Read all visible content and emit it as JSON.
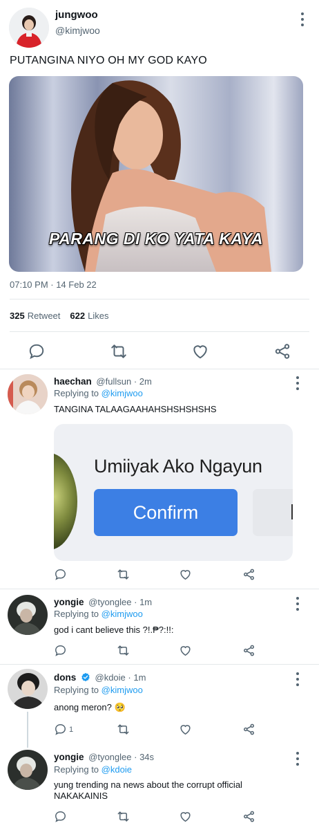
{
  "main_tweet": {
    "display_name": "jungwoo",
    "handle": "@kimjwoo",
    "text": "PUTANGINA NIYO OH MY GOD KAYO",
    "image_caption": "PARANG DI KO YATA KAYA",
    "timestamp": "07:10 PM · 14 Feb 22",
    "stats": {
      "retweets": "325",
      "retweets_label": "Retweet",
      "likes": "622",
      "likes_label": "Likes"
    }
  },
  "replies": [
    {
      "display_name": "haechan",
      "handle": "@fullsun",
      "time": "· 2m",
      "replying_prefix": "Replying to",
      "replying_to": "@kimjwoo",
      "text": "TANGINA TALAAGAAHAHSHSHSHSHS",
      "media": {
        "headline": "Umiiyak Ako Ngayun",
        "button_label": "Confirm"
      }
    },
    {
      "display_name": "yongie",
      "handle": "@tyonglee",
      "time": "· 1m",
      "replying_prefix": "Replying to",
      "replying_to": "@kimjwoo",
      "text": "god i cant believe this ?!.₱?:!!:"
    },
    {
      "display_name": "dons",
      "handle": "@kdoie",
      "time": "· 1m",
      "verified": true,
      "replying_prefix": "Replying to",
      "replying_to": "@kimjwoo",
      "text": "anong meron? 🥺",
      "reply_count": "1"
    },
    {
      "display_name": "yongie",
      "handle": "@tyonglee",
      "time": "· 34s",
      "replying_prefix": "Replying to",
      "replying_to": "@kdoie",
      "text_line1": "yung trending na news about the corrupt official",
      "text_line2": "NAKAKAINIS"
    }
  ],
  "icons": [
    "reply-icon",
    "retweet-icon",
    "like-icon",
    "share-icon",
    "more-icon",
    "verified-badge-icon"
  ],
  "colors": {
    "link": "#1d9bf0",
    "secondary_text": "#536471",
    "verified": "#1d9bf0",
    "confirm_button": "#3c7fe4"
  }
}
